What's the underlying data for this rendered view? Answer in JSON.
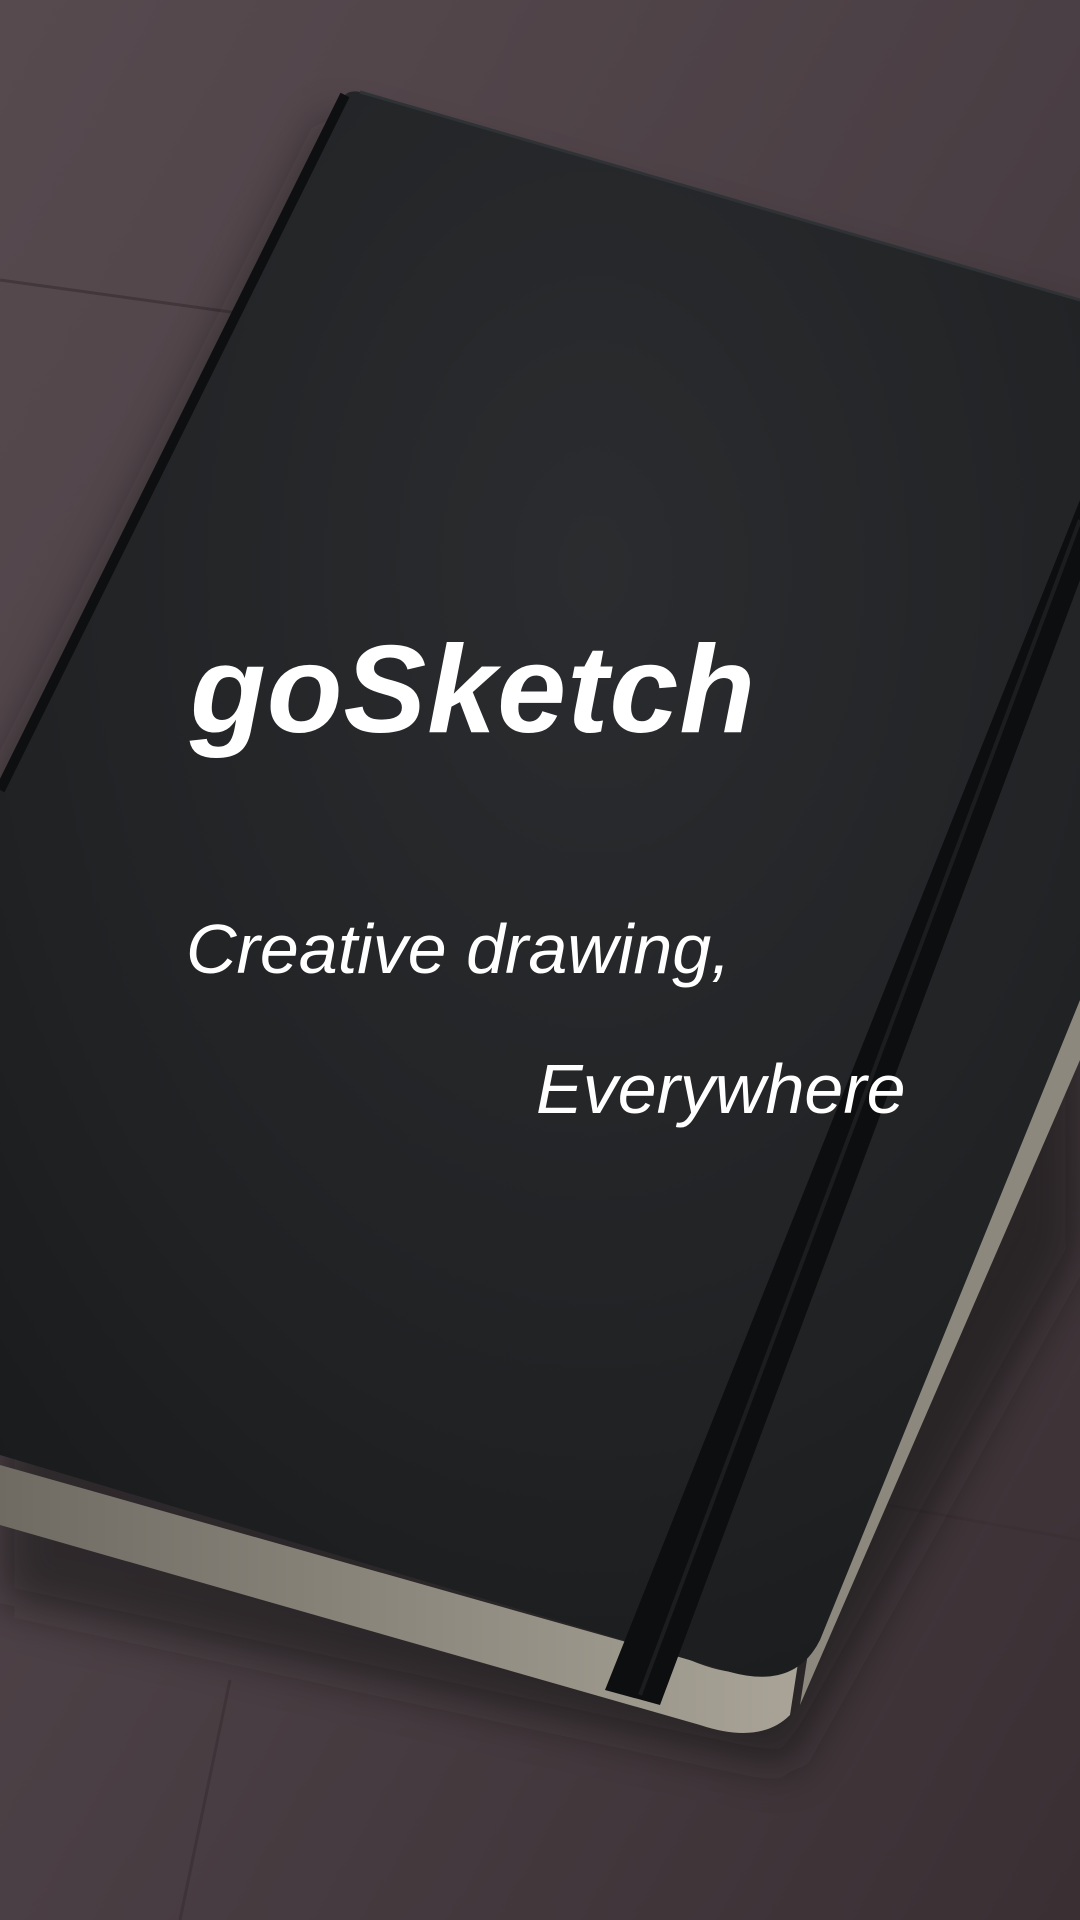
{
  "splash": {
    "app_title": "goSketch",
    "tagline_line1": "Creative drawing,",
    "tagline_line2": "Everywhere"
  },
  "colors": {
    "text": "#ffffff",
    "wood_background": "#4a3f43",
    "notebook_cover": "#1f2123",
    "elastic_band": "#0d0e0f",
    "page_edges": "#9e9a8f"
  }
}
